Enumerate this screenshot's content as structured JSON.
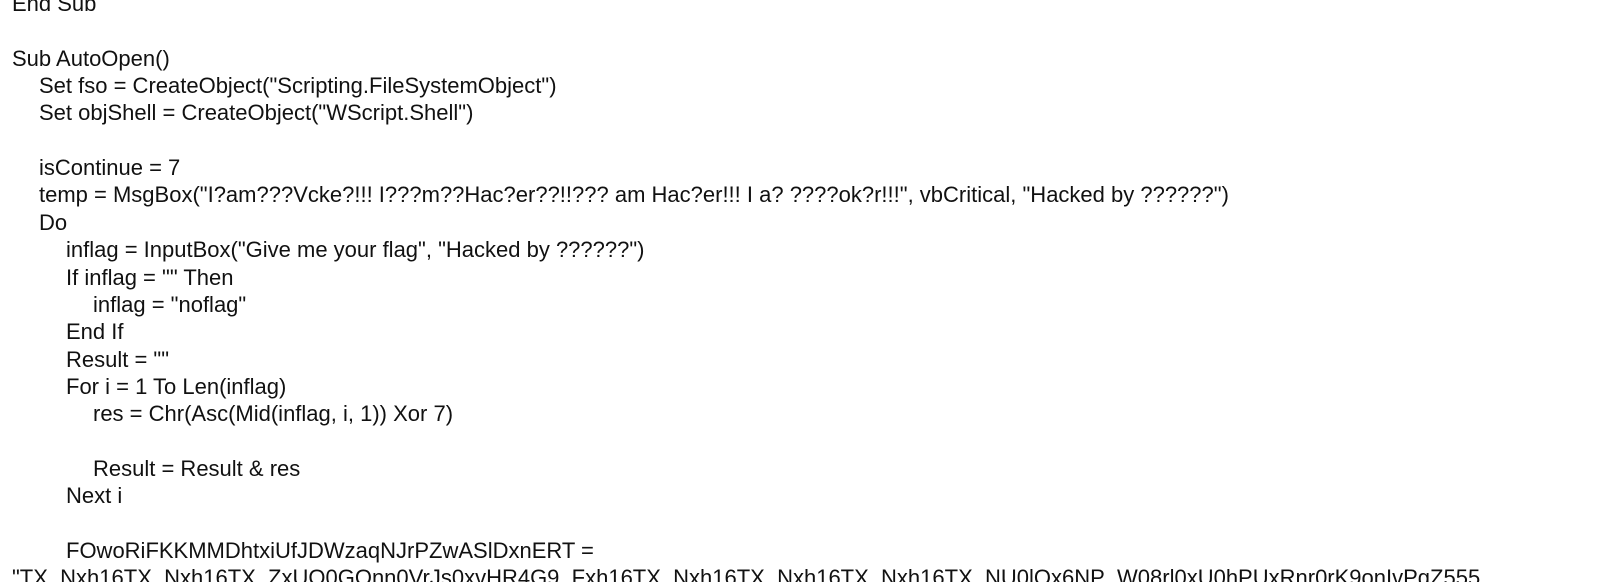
{
  "document": {
    "lines": [
      {
        "indent": 0,
        "text": "End Sub"
      },
      {
        "indent": 0,
        "text": ""
      },
      {
        "indent": 0,
        "text": "Sub AutoOpen()"
      },
      {
        "indent": 1,
        "text": "Set fso = CreateObject(\"Scripting.FileSystemObject\")"
      },
      {
        "indent": 1,
        "text": "Set objShell = CreateObject(\"WScript.Shell\")"
      },
      {
        "indent": 0,
        "text": ""
      },
      {
        "indent": 1,
        "text": "isContinue = 7"
      },
      {
        "indent": 1,
        "text": "temp = MsgBox(\"I?am???Vcke?!!! I???m??Hac?er??!!??? am Hac?er!!! I a? ????ok?r!!!\", vbCritical, \"Hacked by ??????\")"
      },
      {
        "indent": 1,
        "text": "Do"
      },
      {
        "indent": 2,
        "text": "inflag = InputBox(\"Give me your flag\", \"Hacked by ??????\")"
      },
      {
        "indent": 2,
        "text": "If inflag = \"\" Then"
      },
      {
        "indent": 3,
        "text": "inflag = \"noflag\""
      },
      {
        "indent": 2,
        "text": "End If"
      },
      {
        "indent": 2,
        "text": "Result = \"\""
      },
      {
        "indent": 2,
        "text": "For i = 1 To Len(inflag)"
      },
      {
        "indent": 3,
        "text": "res = Chr(Asc(Mid(inflag, i, 1)) Xor 7)"
      },
      {
        "indent": 0,
        "text": ""
      },
      {
        "indent": 3,
        "text": "Result = Result & res"
      },
      {
        "indent": 2,
        "text": "Next i"
      },
      {
        "indent": 0,
        "text": ""
      },
      {
        "indent": 2,
        "text": "FOwoRiFKKMMDhtxiUfJDWzaqNJrPZwASlDxnERT ="
      },
      {
        "indent": 0,
        "text": "\"TX_Nxh16TX_Nxh16TX_ZxUO0GOnn0VrJs0xvHR4G9_Fxh16TX_Nxh16TX_Nxh16TX_Nxh16TX_NU0lQx6NP_W08rl0xU0hPUxRnr0rK9onIvPgZ555"
      }
    ]
  }
}
